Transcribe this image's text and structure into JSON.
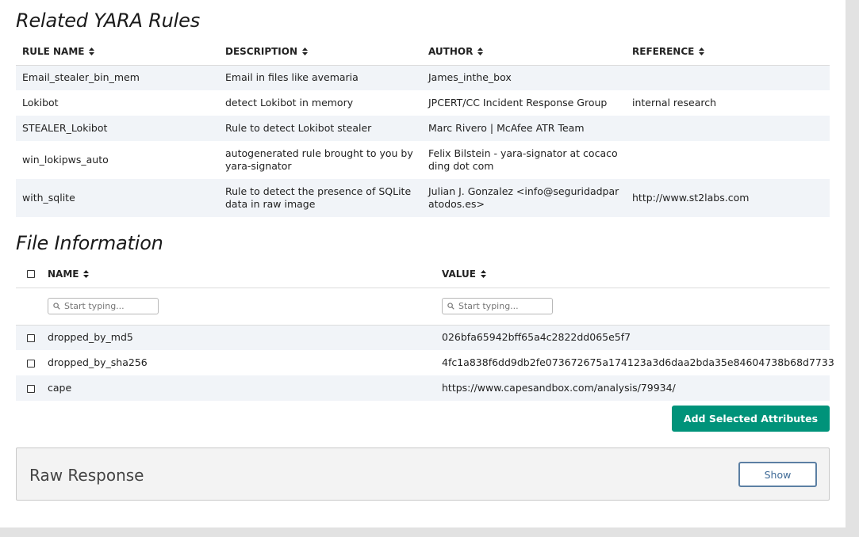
{
  "yara": {
    "title": "Related YARA Rules",
    "columns": {
      "rule_name": "RULE NAME",
      "description": "DESCRIPTION",
      "author": "AUTHOR",
      "reference": "REFERENCE"
    },
    "rows": [
      {
        "rule_name": "Email_stealer_bin_mem",
        "description": "Email in files like avemaria",
        "author": "James_inthe_box",
        "reference": ""
      },
      {
        "rule_name": "Lokibot",
        "description": "detect Lokibot in memory",
        "author": "JPCERT/CC Incident Response Group",
        "reference": "internal research"
      },
      {
        "rule_name": "STEALER_Lokibot",
        "description": "Rule to detect Lokibot stealer",
        "author": "Marc Rivero | McAfee ATR Team",
        "reference": ""
      },
      {
        "rule_name": "win_lokipws_auto",
        "description": "autogenerated rule brought to you by yara-signator",
        "author": "Felix Bilstein - yara-signator at cocacoding dot com",
        "reference": ""
      },
      {
        "rule_name": "with_sqlite",
        "description": "Rule to detect the presence of SQLite data in raw image",
        "author": "Julian J. Gonzalez <info@seguridadparatodos.es>",
        "reference": "http://www.st2labs.com"
      }
    ]
  },
  "file_info": {
    "title": "File Information",
    "columns": {
      "name": "NAME",
      "value": "VALUE"
    },
    "filters": {
      "name_placeholder": "Start typing...",
      "value_placeholder": "Start typing..."
    },
    "rows": [
      {
        "name": "dropped_by_md5",
        "value": "026bfa65942bff65a4c2822dd065e5f7"
      },
      {
        "name": "dropped_by_sha256",
        "value": "4fc1a838f6dd9db2fe073672675a174123a3d6daa2bda35e84604738b68d7733"
      },
      {
        "name": "cape",
        "value": "https://www.capesandbox.com/analysis/79934/"
      }
    ],
    "add_button_label": "Add Selected Attributes"
  },
  "raw_response": {
    "title": "Raw Response",
    "show_label": "Show"
  },
  "icons": {
    "sort": "sort-icon",
    "search": "search-icon",
    "checkbox": "checkbox"
  },
  "colors": {
    "accent_green": "#00937a",
    "row_stripe": "#f1f4f8",
    "show_border": "#5b7fa3"
  }
}
